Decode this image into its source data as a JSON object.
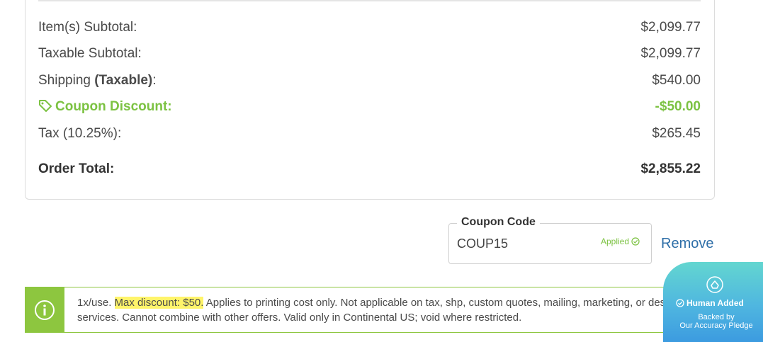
{
  "summary": {
    "rows": [
      {
        "label": "Item(s) Subtotal:",
        "value": "$2,099.77"
      },
      {
        "label": "Taxable Subtotal:",
        "value": "$2,099.77"
      },
      {
        "label_prefix": "Shipping ",
        "label_bold": "(Taxable)",
        "label_suffix": ":",
        "value": "$540.00"
      },
      {
        "label": "Coupon Discount:",
        "value": "-$50.00"
      },
      {
        "label": "Tax (10.25%):",
        "value": "$265.45"
      }
    ],
    "total": {
      "label": "Order Total:",
      "value": "$2,855.22"
    }
  },
  "coupon": {
    "legend": "Coupon Code",
    "value": "COUP15",
    "status": "Applied",
    "remove_label": "Remove"
  },
  "notice": {
    "prefix": "1x/use. ",
    "highlight": "Max discount: $50.",
    "text": " Applies to printing cost only. Not applicable on tax, shp, custom quotes, mailing, marketing, or design services. Cannot combine with other offers. Valid only in Continental US; void where restricted."
  },
  "badge": {
    "title": "Human Added",
    "line1": "Backed by",
    "line2": "Our Accuracy Pledge"
  },
  "colors": {
    "accent_green": "#7cc242",
    "link_blue": "#2f6fa8",
    "highlight": "#fff46a"
  }
}
